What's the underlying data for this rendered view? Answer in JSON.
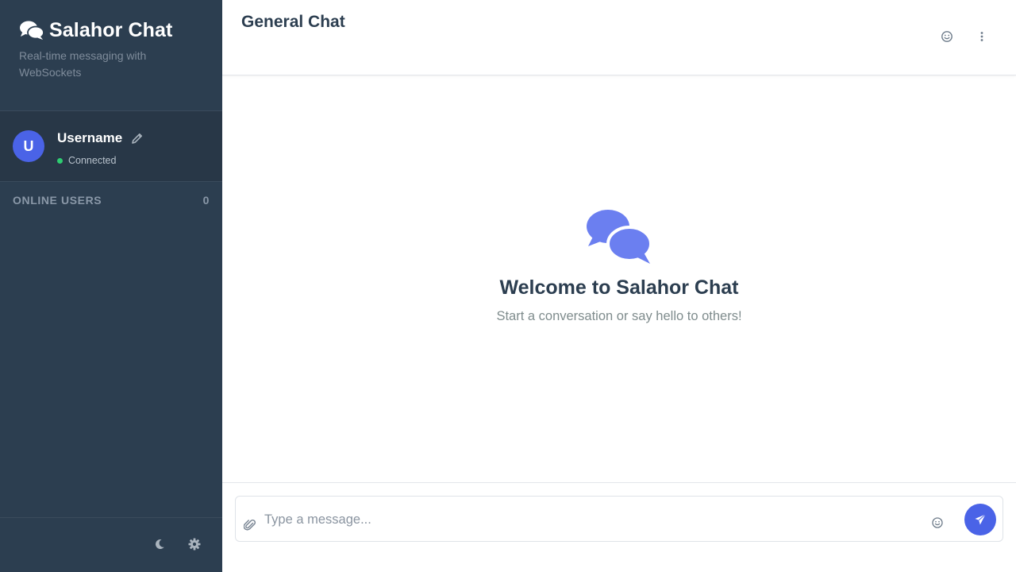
{
  "sidebar": {
    "app_title": "Salahor Chat",
    "app_subtitle": "Real-time messaging with WebSockets",
    "user": {
      "avatar_initial": "U",
      "name": "Username",
      "status": "Connected"
    },
    "online_users": {
      "label": "ONLINE USERS",
      "count": "0"
    },
    "footer_icons": [
      "moon-icon",
      "gear-icon"
    ]
  },
  "header": {
    "title": "General Chat",
    "icons": [
      "emoji-icon",
      "more-vertical-icon"
    ]
  },
  "welcome": {
    "title": "Welcome to Salahor Chat",
    "subtitle": "Start a conversation or say hello to others!"
  },
  "composer": {
    "placeholder": "Type a message...",
    "value": ""
  },
  "colors": {
    "sidebar_bg": "#2c3e50",
    "accent": "#4a63e7",
    "online_dot": "#2ecc71",
    "chat_icon": "#6b7ff0"
  }
}
